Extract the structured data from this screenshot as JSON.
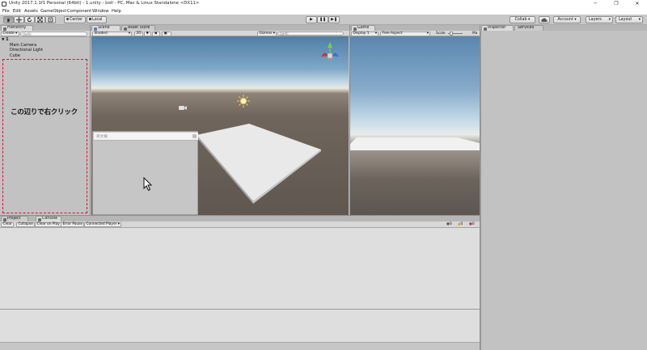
{
  "window": {
    "title": "Unity 2017.1.1f1 Personal (64bit) - 1.unity - boll - PC, Mac & Linux Standalone <DX11>",
    "controls": [
      "─",
      "❐",
      "✕"
    ]
  },
  "menu": [
    "File",
    "Edit",
    "Assets",
    "GameObject",
    "Component",
    "Window",
    "Help"
  ],
  "toolbar": {
    "tools": [
      "hand-tool",
      "move-tool",
      "rotate-tool",
      "scale-tool",
      "rect-tool"
    ],
    "pivot": "Center",
    "space": "Local",
    "play": [
      "▶",
      "❚❚",
      "▶❚"
    ],
    "collab": "Collab ▾",
    "account": "Account ▾",
    "layers": "Layers",
    "layout": "Layout"
  },
  "hierarchy": {
    "tab": "Hierarchy",
    "create": "Create ▾",
    "search_placeholder": "Q▾All",
    "scene": "1",
    "items": [
      "Main Camera",
      "Directional Light",
      "Cube"
    ],
    "hint": "この辺りで右クリック"
  },
  "scene": {
    "tab": "Scene",
    "asset_store_tab": "Asset Store",
    "shading": "Shaded",
    "mode_2d": "2D",
    "gizmos": "Gizmos ▾",
    "search_placeholder": "Q▾All"
  },
  "context_menu": {
    "search_placeholder": "英文検"
  },
  "game": {
    "tab": "Game",
    "display": "Display 1",
    "aspect": "Free Aspect",
    "scale": "Scale",
    "maximize": "Ma"
  },
  "inspector": {
    "tab": "Inspector",
    "services_tab": "Services"
  },
  "project": {
    "tab": "Project",
    "console_tab": "Console"
  },
  "console": {
    "buttons": [
      "Clear",
      "Collapse",
      "Clear on Play",
      "Error Pause",
      "Connected Player ▾"
    ],
    "counts": [
      "0",
      "0",
      "0"
    ]
  },
  "colors": {
    "accent_dashed": "#d3162d",
    "sky": "#7ea7c8",
    "ground": "#6f655c"
  }
}
